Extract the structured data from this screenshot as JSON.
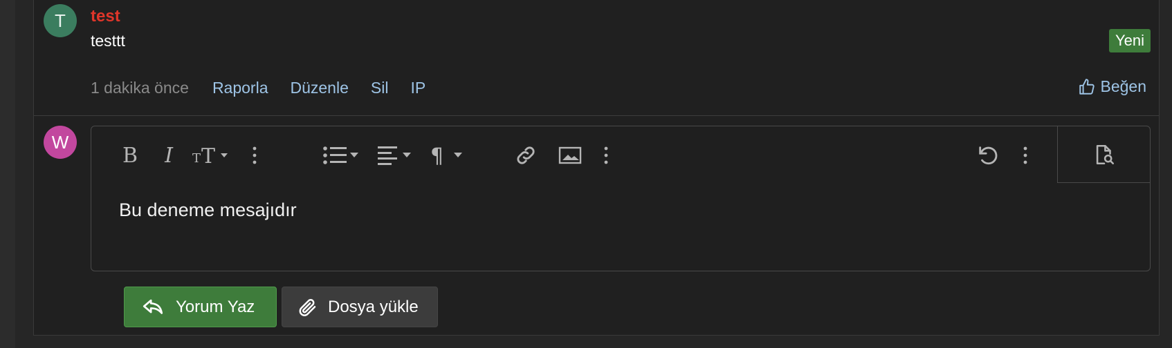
{
  "comment": {
    "avatar_letter": "T",
    "username": "test",
    "text": "testtt",
    "badge": "Yeni",
    "time": "1 dakika önce",
    "actions": [
      "Raporla",
      "Düzenle",
      "Sil",
      "IP"
    ],
    "like_label": "Beğen"
  },
  "reply": {
    "avatar_letter": "W",
    "editor_text": "Bu deneme mesajıdır",
    "toolbar_icons": [
      "bold-icon",
      "italic-icon",
      "text-size-icon",
      "more-icon",
      "list-icon",
      "align-icon",
      "paragraph-icon",
      "link-icon",
      "image-icon",
      "more-icon",
      "undo-icon",
      "more-icon",
      "preview-icon"
    ],
    "submit_label": "Yorum Yaz",
    "upload_label": "Dosya yükle"
  },
  "colors": {
    "accent_green": "#3e7c3b",
    "username_red": "#e0362a",
    "link_blue": "#9ec4e6",
    "avatar_t": "#3b7d5f",
    "avatar_w": "#c2479e"
  }
}
